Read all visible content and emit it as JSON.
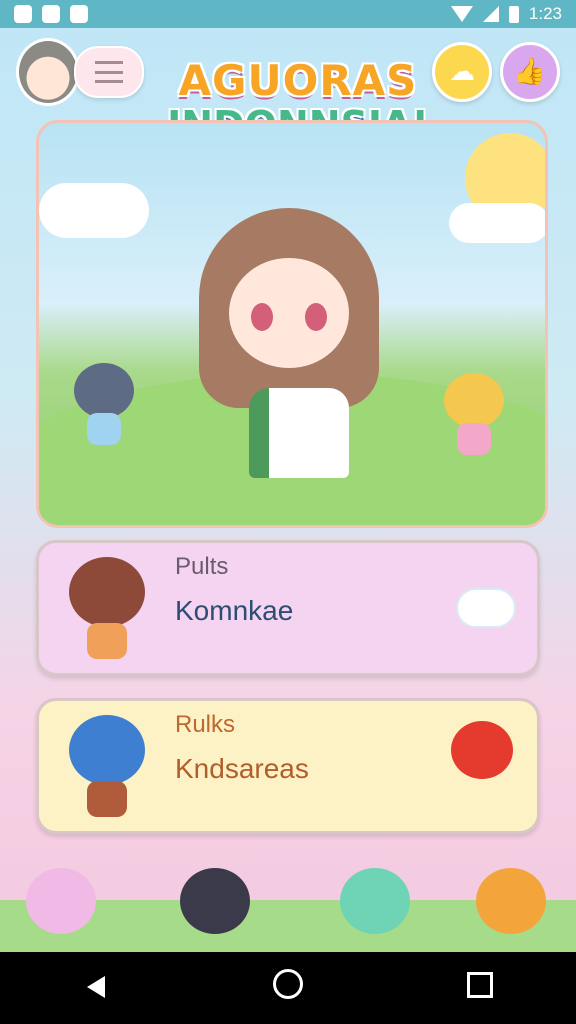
{
  "status_bar": {
    "time": "1:23",
    "app_icons": [
      "app-icon-1",
      "app-icon-2",
      "app-icon-3"
    ]
  },
  "header": {
    "logo_line1": "AGUORAS",
    "logo_line2": "INDONNSIA!",
    "avatar": "avatar",
    "menu_icon": "menu-icon",
    "cloud_button_icon": "cloud-icon",
    "thumbs_button_icon": "thumbs-up-icon"
  },
  "cards": [
    {
      "title": "Pults",
      "subtitle": "Komnkae",
      "deco_icon": "cloud-icon"
    },
    {
      "title": "Rulks",
      "subtitle": "Kndsareas",
      "deco_icon": "apple-icon"
    }
  ],
  "colors": {
    "status_bar": "#5fb6c4",
    "card1_bg": "#f4d4f1",
    "card2_bg": "#fcf2c5",
    "logo_orange": "#f6a526",
    "logo_green": "#46b98b"
  }
}
